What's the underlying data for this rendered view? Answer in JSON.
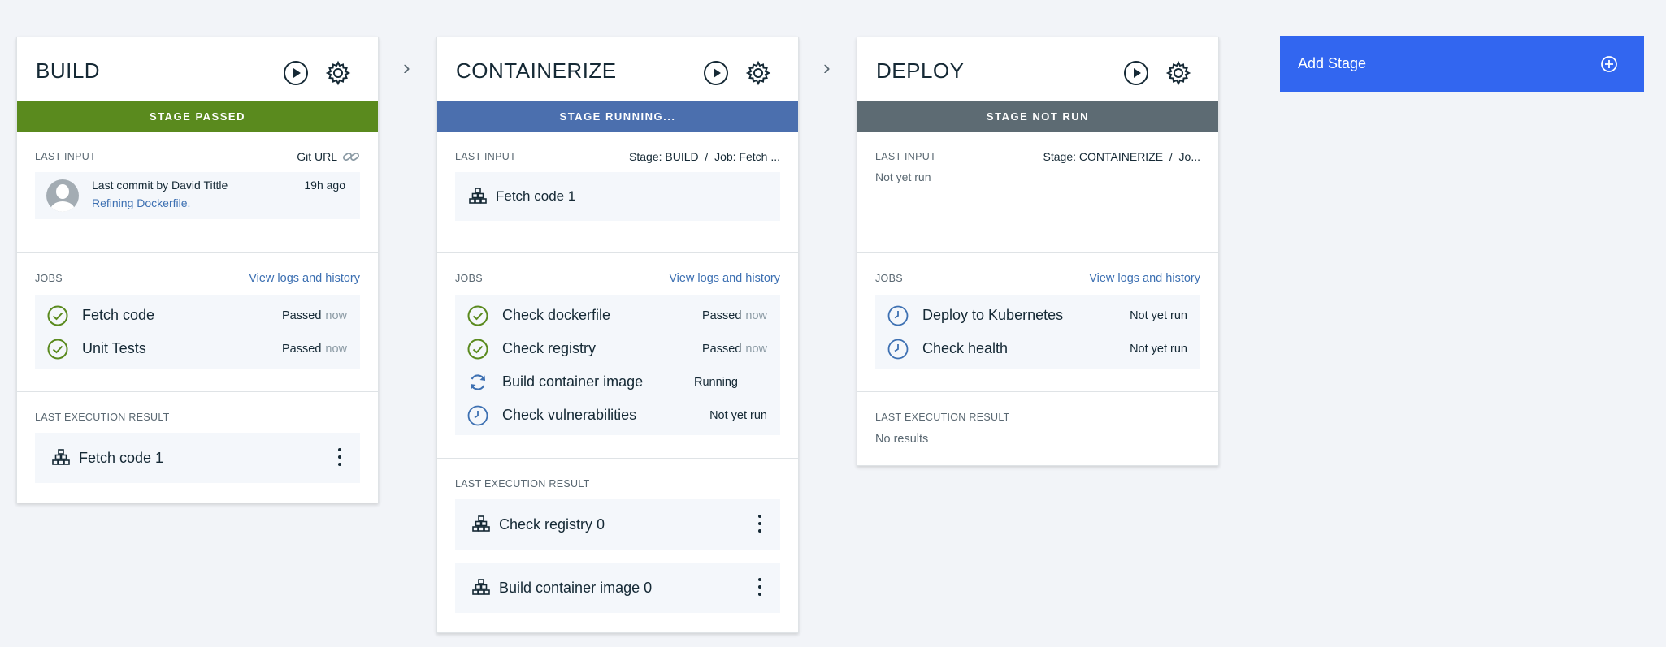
{
  "stages": [
    {
      "title": "BUILD",
      "status": "STAGE PASSED",
      "status_color": "#5a8a1e",
      "last_input_label": "LAST INPUT",
      "input_source": "Git URL",
      "commit_author": "Last commit by David Tittle",
      "commit_message": "Refining Dockerfile.",
      "commit_time": "19h ago",
      "jobs_label": "JOBS",
      "view_logs": "View logs and history",
      "jobs": [
        {
          "name": "Fetch code",
          "status": "Passed",
          "when": "now",
          "icon": "check-circle-icon"
        },
        {
          "name": "Unit Tests",
          "status": "Passed",
          "when": "now",
          "icon": "check-circle-icon"
        }
      ],
      "last_result_label": "LAST EXECUTION RESULT",
      "results": [
        "Fetch code 1"
      ]
    },
    {
      "title": "CONTAINERIZE",
      "status": "STAGE RUNNING...",
      "status_color": "#4b6fae",
      "last_input_label": "LAST INPUT",
      "input_source": "Stage: BUILD  /  Job: Fetch ...",
      "input_item": "Fetch code 1",
      "jobs_label": "JOBS",
      "view_logs": "View logs and history",
      "jobs": [
        {
          "name": "Check dockerfile",
          "status": "Passed",
          "when": "now",
          "icon": "check-circle-icon"
        },
        {
          "name": "Check registry",
          "status": "Passed",
          "when": "now",
          "icon": "check-circle-icon"
        },
        {
          "name": "Build container image",
          "status": "Running",
          "when": "",
          "icon": "refresh-icon"
        },
        {
          "name": "Check vulnerabilities",
          "status": "Not yet run",
          "when": "",
          "icon": "clock-icon"
        }
      ],
      "last_result_label": "LAST EXECUTION RESULT",
      "results": [
        "Check registry 0",
        "Build container image 0"
      ]
    },
    {
      "title": "DEPLOY",
      "status": "STAGE NOT RUN",
      "status_color": "#5d6b73",
      "last_input_label": "LAST INPUT",
      "input_source": "Stage: CONTAINERIZE  /  Jo...",
      "input_none": "Not yet run",
      "jobs_label": "JOBS",
      "view_logs": "View logs and history",
      "jobs": [
        {
          "name": "Deploy to Kubernetes",
          "status": "Not yet run",
          "when": "",
          "icon": "clock-icon"
        },
        {
          "name": "Check health",
          "status": "Not yet run",
          "when": "",
          "icon": "clock-icon"
        }
      ],
      "last_result_label": "LAST EXECUTION RESULT",
      "no_results": "No results"
    }
  ],
  "chevron": "›",
  "add_stage": {
    "label": "Add Stage",
    "icon": "add-circle-icon",
    "color": "#3266f0"
  }
}
